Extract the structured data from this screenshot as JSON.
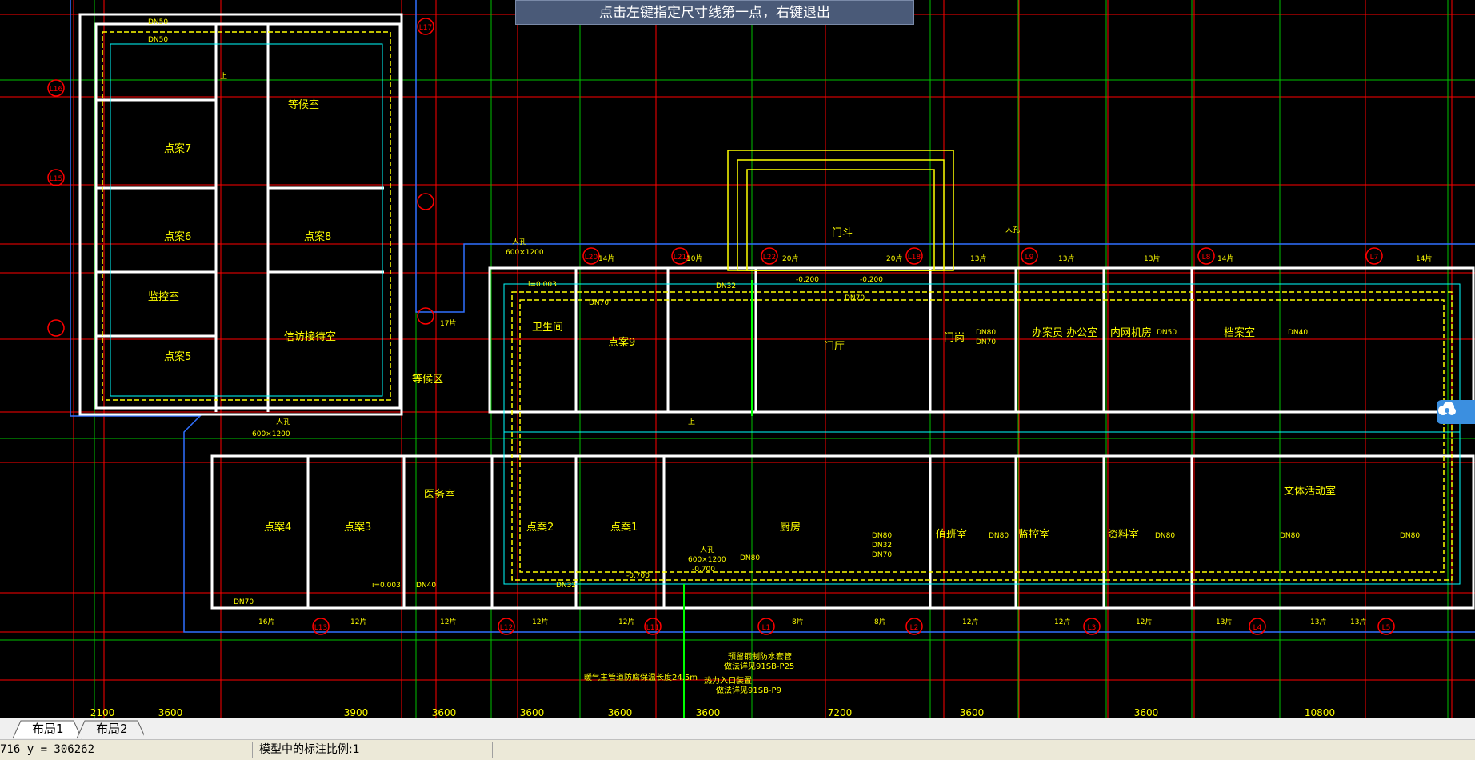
{
  "prompt": {
    "text": "点击左键指定尺寸线第一点，右键退出"
  },
  "rooms": {
    "waiting_room": "等候室",
    "record_7": "点案7",
    "record_6": "点案6",
    "record_8": "点案8",
    "monitoring": "监控室",
    "record_5": "点案5",
    "custody_room": "信访接待室",
    "waiting_area": "等候区",
    "toilet": "卫生间",
    "record_9": "点案9",
    "hall": "门厅",
    "entrance": "门斗",
    "guard": "门岗",
    "office": "办案员\n办公室",
    "network": "内网机房",
    "archive": "档案室",
    "record_4": "点案4",
    "record_3": "点案3",
    "medical": "医务室",
    "record_2": "点案2",
    "record_1": "点案1",
    "kitchen": "厨房",
    "duty": "值班室",
    "monitor2": "监控室",
    "info": "资料室",
    "activity": "文体活动室"
  },
  "axis_labels": [
    "L17",
    "L16",
    "L15",
    "L20",
    "L21",
    "L22",
    "L18",
    "L9",
    "L8",
    "L7",
    "L13",
    "L12",
    "L11",
    "L1",
    "L2",
    "L3",
    "L4",
    "L5"
  ],
  "dimensions_bottom": [
    "2100",
    "3600",
    "3900",
    "3600",
    "3600",
    "3600",
    "3600",
    "7200",
    "3600",
    "3600",
    "10800"
  ],
  "pipe_labels": {
    "dn50": "DN50",
    "dn70": "DN70",
    "dn40": "DN40",
    "dn32": "DN32",
    "dn80": "DN80",
    "manhole": "人孔",
    "manhole_size": "600×1200",
    "slope": "i=0.003",
    "elev1": "-0.200",
    "elev2": "-0.700",
    "elev3": "-0.200",
    "piece_count_a": "13片",
    "piece_count_b": "12片",
    "piece_count_c": "20片",
    "piece_count_d": "14片",
    "piece_count_e": "16片",
    "piece_count_f": "8片",
    "piece_count_g": "10片",
    "piece_count_h": "17片",
    "up": "上"
  },
  "notes": {
    "n1": "预留钢制防水套管",
    "n2": "做法详见91SB-P25",
    "n3": "暖气主管道防腐保温",
    "n4": "热力入口装置",
    "n5": "做法详见91SB-P9",
    "n6": "暖气主管道防腐保温长度24.5m"
  },
  "tabs": [
    {
      "label": "布局1"
    },
    {
      "label": "布局2"
    }
  ],
  "status": {
    "coords": "716 y = 306262",
    "scale_note": "模型中的标注比例:1"
  },
  "colors": {
    "grid_red": "#ff0000",
    "grid_green": "#00c000",
    "wall_white": "#ffffff",
    "pipe_yellow": "#ffff00",
    "cyan": "#00ffff",
    "prompt_bg": "#4a5a78"
  }
}
